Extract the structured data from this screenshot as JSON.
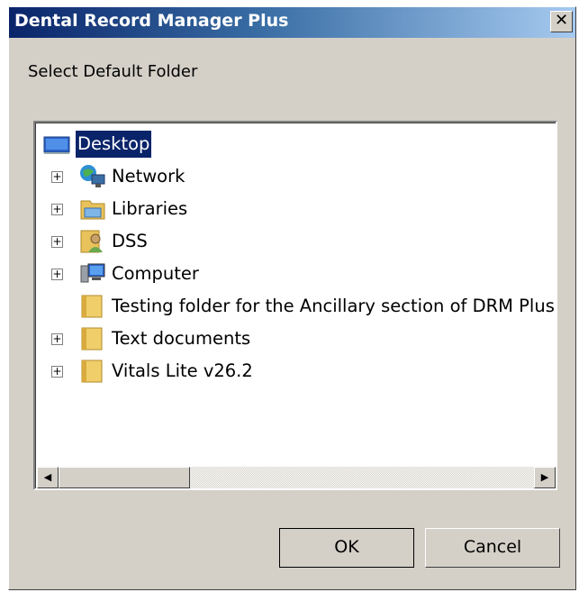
{
  "window": {
    "title": "Dental Record Manager Plus",
    "close_glyph": "✕"
  },
  "prompt": "Select Default Folder",
  "tree": {
    "root": {
      "label": "Desktop",
      "icon": "desktop-icon"
    },
    "items": [
      {
        "label": "Network",
        "icon": "network-icon",
        "expandable": true
      },
      {
        "label": "Libraries",
        "icon": "libraries-icon",
        "expandable": true
      },
      {
        "label": "DSS",
        "icon": "user-folder-icon",
        "expandable": true
      },
      {
        "label": "Computer",
        "icon": "computer-icon",
        "expandable": true
      },
      {
        "label": "Testing folder for the Ancillary section of DRM Plus",
        "icon": "folder-icon",
        "expandable": false
      },
      {
        "label": "Text documents",
        "icon": "folder-icon",
        "expandable": true
      },
      {
        "label": "Vitals Lite v26.2",
        "icon": "folder-icon",
        "expandable": true
      }
    ],
    "expand_glyph": "+"
  },
  "scrollbar": {
    "left_glyph": "◀",
    "right_glyph": "▶"
  },
  "buttons": {
    "ok": "OK",
    "cancel": "Cancel"
  },
  "colors": {
    "selection": "#0a246a",
    "dialog_bg": "#d4d0c8"
  }
}
